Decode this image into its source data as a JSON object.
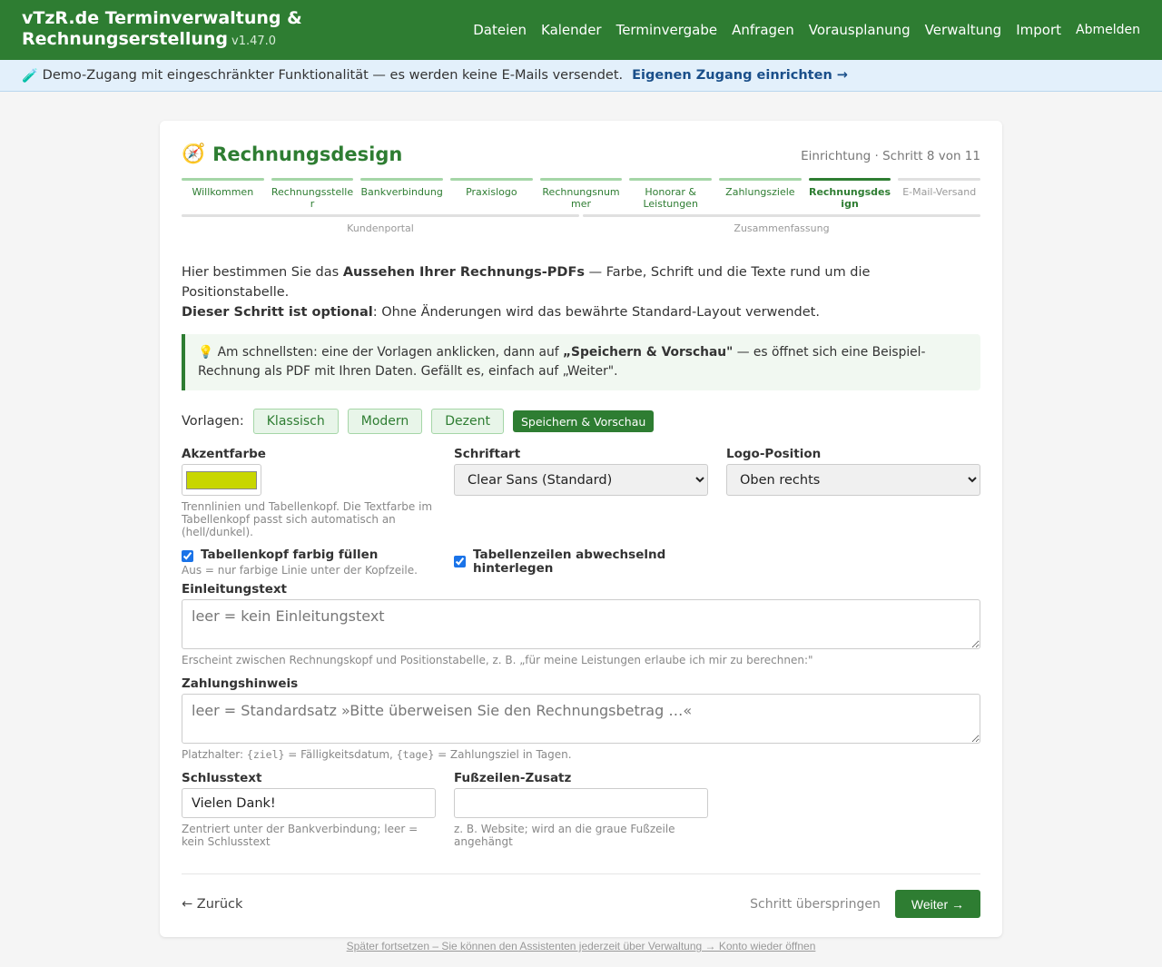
{
  "header": {
    "title_line1": "vTzR.de Terminverwaltung &",
    "title_line2": "Rechnungserstellung",
    "version": "v1.47.0",
    "nav": [
      "Dateien",
      "Kalender",
      "Terminvergabe",
      "Anfragen",
      "Vorausplanung",
      "Verwaltung",
      "Import"
    ],
    "logout": "Abmelden"
  },
  "banner": {
    "icon": "🧪",
    "text": "Demo-Zugang mit eingeschränkter Funktionalität — es werden keine E-Mails versendet.",
    "link": "Eigenen Zugang einrichten →"
  },
  "page": {
    "icon": "🧭",
    "title": "Rechnungsdesign",
    "step_info": "Einrichtung · Schritt 8 von 11"
  },
  "steps": [
    "Willkommen",
    "Rechnungssteller",
    "Bankverbindung",
    "Praxislogo",
    "Rechnungsnummer",
    "Honorar & Leistungen",
    "Zahlungsziele",
    "Rechnungsdesign",
    "E-Mail-Versand"
  ],
  "steps_row2": [
    "Kundenportal",
    "Zusammenfassung"
  ],
  "intro": {
    "p1_a": "Hier bestimmen Sie das ",
    "p1_b": "Aussehen Ihrer Rechnungs-PDFs",
    "p1_c": " — Farbe, Schrift und die Texte rund um die Positionstabelle.",
    "p2_a": "Dieser Schritt ist optional",
    "p2_b": ": Ohne Änderungen wird das bewährte Standard-Layout verwendet."
  },
  "hint": {
    "icon": "💡",
    "a": " Am schnellsten: eine der Vorlagen anklicken, dann auf ",
    "b": "„Speichern & Vorschau\"",
    "c": " — es öffnet sich eine Beispiel-Rechnung als PDF mit Ihren Daten. Gefällt es, einfach auf „Weiter\"."
  },
  "templates": {
    "label": "Vorlagen:",
    "items": [
      "Klassisch",
      "Modern",
      "Dezent"
    ],
    "save_preview": "Speichern & Vorschau"
  },
  "accent": {
    "label": "Akzentfarbe",
    "color": "#c8d600",
    "help": "Trennlinien und Tabellenkopf. Die Textfarbe im Tabellenkopf passt sich automatisch an (hell/dunkel)."
  },
  "font": {
    "label": "Schriftart",
    "value": "Clear Sans (Standard)"
  },
  "logo": {
    "label": "Logo-Position",
    "value": "Oben rechts"
  },
  "checks": {
    "fill_header": "Tabellenkopf farbig füllen",
    "fill_header_help": "Aus = nur farbige Linie unter der Kopfzeile.",
    "alt_rows": "Tabellenzeilen abwechselnd hinterlegen"
  },
  "intro_text": {
    "label": "Einleitungstext",
    "placeholder": "leer = kein Einleitungstext",
    "help": "Erscheint zwischen Rechnungskopf und Positionstabelle, z. B. „für meine Leistungen erlaube ich mir zu berechnen:\""
  },
  "payment": {
    "label": "Zahlungshinweis",
    "placeholder": "leer = Standardsatz »Bitte überweisen Sie den Rechnungsbetrag …«",
    "help_a": "Platzhalter: ",
    "code1": "{ziel}",
    "help_b": " = Fälligkeitsdatum, ",
    "code2": "{tage}",
    "help_c": " = Zahlungsziel in Tagen."
  },
  "closing": {
    "label": "Schlusstext",
    "value": "Vielen Dank!",
    "help": "Zentriert unter der Bankverbindung; leer = kein Schlusstext"
  },
  "footer_add": {
    "label": "Fußzeilen-Zusatz",
    "value": "",
    "help": "z. B. Website; wird an die graue Fußzeile angehängt"
  },
  "actions": {
    "back": "← Zurück",
    "skip": "Schritt überspringen",
    "next": "Weiter →",
    "later": "Später fortsetzen – Sie können den Assistenten jederzeit über Verwaltung → Konto wieder öffnen"
  }
}
